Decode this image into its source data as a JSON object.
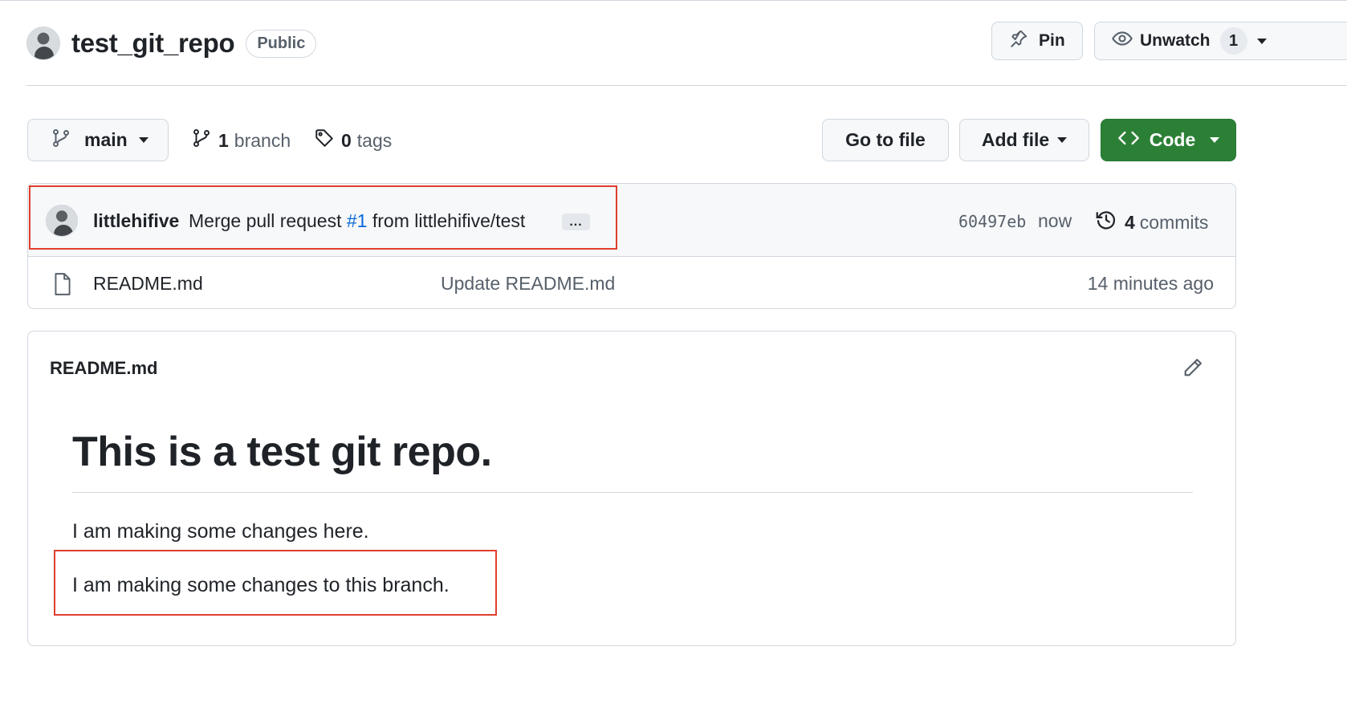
{
  "repo": {
    "name": "test_git_repo",
    "visibility": "Public",
    "pin_label": "Pin",
    "watch_label": "Unwatch",
    "watch_count": "1"
  },
  "toolbar": {
    "branch": "main",
    "branch_count": "1",
    "branch_label": "branch",
    "tag_count": "0",
    "tag_label": "tags",
    "go_to_file": "Go to file",
    "add_file": "Add file",
    "code": "Code"
  },
  "commit": {
    "author": "littlehifive",
    "message_prefix": "Merge pull request",
    "pr": "#1",
    "message_suffix": "from littlehifive/test",
    "ellipsis": "...",
    "sha": "60497eb",
    "time": "now",
    "commit_count": "4",
    "commits_label": "commits"
  },
  "files": [
    {
      "name": "README.md",
      "message": "Update README.md",
      "age": "14 minutes ago"
    }
  ],
  "readme": {
    "title": "README.md",
    "heading": "This is a test git repo.",
    "paragraphs": [
      "I am making some changes here.",
      "I am making some changes to this branch."
    ]
  },
  "icons": {
    "pin": "pin-icon",
    "eye": "eye-icon",
    "branch": "git-branch-icon",
    "tag": "tag-icon",
    "code": "code-icon",
    "history": "history-icon",
    "file": "file-icon",
    "edit": "pencil-icon"
  },
  "colors": {
    "code_button": "#2c8036",
    "link": "#0969da",
    "highlight": "#e03e2f"
  }
}
